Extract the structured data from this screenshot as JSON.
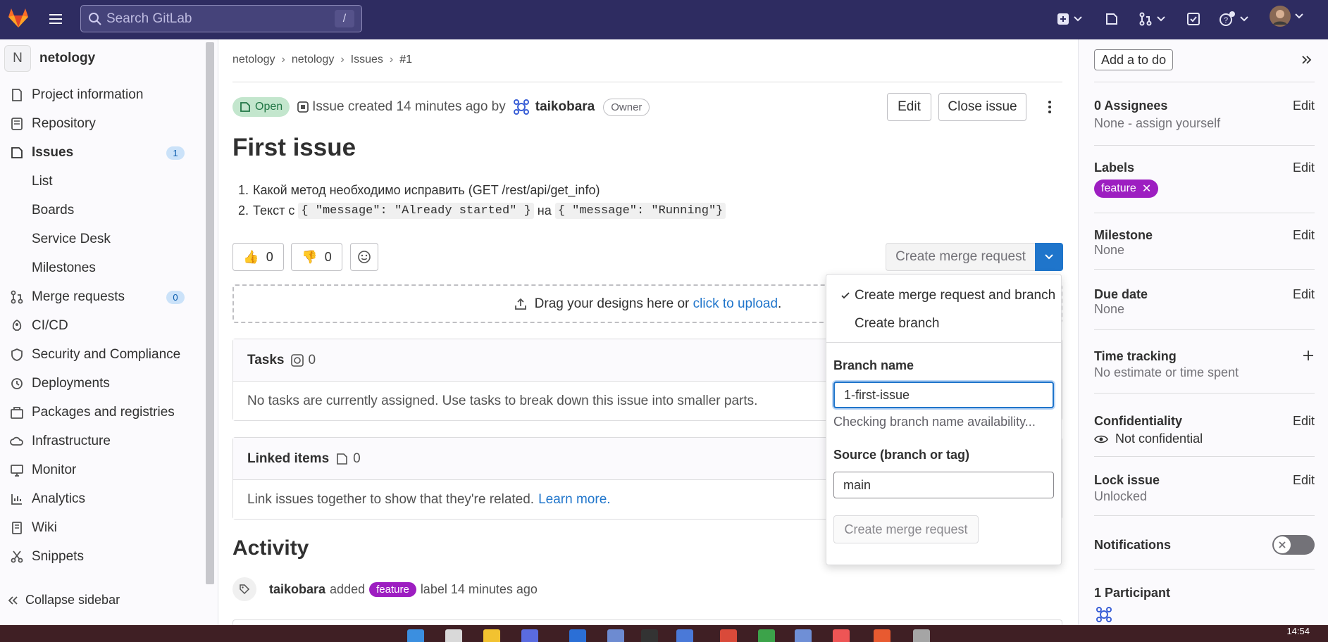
{
  "topbar": {
    "search_placeholder": "Search GitLab",
    "search_shortcut": "/"
  },
  "sidebar": {
    "project_initial": "N",
    "project_name": "netology",
    "items": [
      {
        "label": "Project information",
        "icon": "info-icon"
      },
      {
        "label": "Repository",
        "icon": "book-icon"
      },
      {
        "label": "Issues",
        "icon": "issues-icon",
        "badge": "1"
      },
      {
        "label": "List"
      },
      {
        "label": "Boards"
      },
      {
        "label": "Service Desk"
      },
      {
        "label": "Milestones"
      },
      {
        "label": "Merge requests",
        "icon": "merge-request-icon",
        "badge": "0"
      },
      {
        "label": "CI/CD",
        "icon": "rocket-icon"
      },
      {
        "label": "Security and Compliance",
        "icon": "shield-icon"
      },
      {
        "label": "Deployments",
        "icon": "deployments-icon"
      },
      {
        "label": "Packages and registries",
        "icon": "package-icon"
      },
      {
        "label": "Infrastructure",
        "icon": "cloud-icon"
      },
      {
        "label": "Monitor",
        "icon": "monitor-icon"
      },
      {
        "label": "Analytics",
        "icon": "chart-icon"
      },
      {
        "label": "Wiki",
        "icon": "wiki-icon"
      },
      {
        "label": "Snippets",
        "icon": "snippet-icon"
      }
    ],
    "collapse_label": "Collapse sidebar"
  },
  "breadcrumb": [
    "netology",
    "netology",
    "Issues",
    "#1"
  ],
  "issue": {
    "status": "Open",
    "created_text": "Issue created 14 minutes ago by",
    "author": "taikobara",
    "author_role": "Owner",
    "edit_label": "Edit",
    "close_label": "Close issue",
    "title": "First issue",
    "desc_1": "Какой метод необходимо исправить (GET /rest/api/get_info)",
    "desc_2_prefix": "Текст с",
    "desc_2_code1": "{ \"message\": \"Already started\" }",
    "desc_2_mid": "на",
    "desc_2_code2": "{ \"message\": \"Running\"}",
    "thumbs_up": "0",
    "thumbs_down": "0",
    "create_mr_label": "Create merge request",
    "dropzone_text": "Drag your designs here or",
    "dropzone_link": "click to upload",
    "dropzone_end": "."
  },
  "tasks": {
    "title": "Tasks",
    "count": "0",
    "empty_text": "No tasks are currently assigned. Use tasks to break down this issue into smaller parts."
  },
  "linked": {
    "title": "Linked items",
    "count": "0",
    "text": "Link issues together to show that they're related.",
    "link": "Learn more."
  },
  "activity": {
    "title": "Activity",
    "user": "taikobara",
    "action": "added",
    "label": "feature",
    "suffix": "label 14 minutes ago"
  },
  "dropdown": {
    "option1": "Create merge request and branch",
    "option2": "Create branch",
    "branch_label": "Branch name",
    "branch_value": "1-first-issue",
    "branch_help": "Checking branch name availability...",
    "source_label": "Source (branch or tag)",
    "source_value": "main",
    "submit_label": "Create merge request"
  },
  "right_sidebar": {
    "todo_label": "Add a to do",
    "edit_label": "Edit",
    "assignees_title": "0 Assignees",
    "assignees_value": "None - assign yourself",
    "labels_title": "Labels",
    "label_name": "feature",
    "milestone_title": "Milestone",
    "milestone_value": "None",
    "due_title": "Due date",
    "due_value": "None",
    "time_title": "Time tracking",
    "time_value": "No estimate or time spent",
    "conf_title": "Confidentiality",
    "conf_value": "Not confidential",
    "lock_title": "Lock issue",
    "lock_value": "Unlocked",
    "notif_title": "Notifications",
    "participants_title": "1 Participant"
  },
  "taskbar": {
    "clock": "14:54"
  },
  "colors": {
    "topbar": "#2e2c61",
    "accent": "#1f75cb",
    "label": "#9d1ec1",
    "open": "#217645"
  }
}
